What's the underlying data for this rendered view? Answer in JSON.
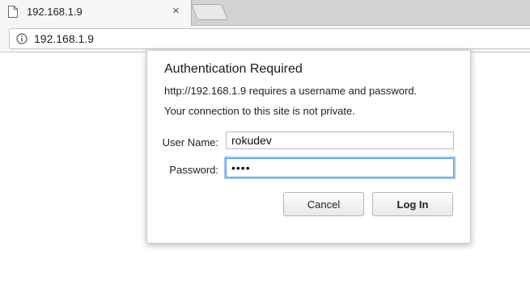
{
  "browser": {
    "tab": {
      "title": "192.168.1.9",
      "close_glyph": "×"
    },
    "omnibox": {
      "url": "192.168.1.9",
      "security_icon": "info-icon"
    }
  },
  "dialog": {
    "title": "Authentication Required",
    "message_line1": "http://192.168.1.9 requires a username and password.",
    "message_line2": "Your connection to this site is not private.",
    "username": {
      "label": "User Name:",
      "value": "rokudev"
    },
    "password": {
      "label": "Password:",
      "value": "••••"
    },
    "buttons": {
      "cancel": "Cancel",
      "login": "Log In"
    }
  },
  "colors": {
    "focus_ring": "#9cc4f3",
    "tabstrip": "#d2d2d2"
  }
}
